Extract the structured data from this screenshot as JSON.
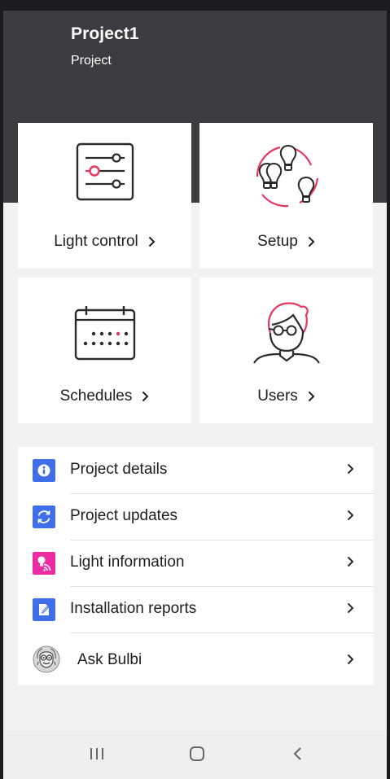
{
  "header": {
    "title": "Project1",
    "subtitle": "Project"
  },
  "tiles": [
    {
      "label": "Light control",
      "icon": "sliders-icon"
    },
    {
      "label": "Setup",
      "icon": "bulbs-setup-icon"
    },
    {
      "label": "Schedules",
      "icon": "calendar-icon"
    },
    {
      "label": "Users",
      "icon": "user-icon"
    }
  ],
  "menu": [
    {
      "label": "Project details",
      "icon": "info-icon",
      "color": "#3f6ee8"
    },
    {
      "label": "Project updates",
      "icon": "sync-icon",
      "color": "#3f6ee8"
    },
    {
      "label": "Light information",
      "icon": "light-info-icon",
      "color": "#ec2ca5"
    },
    {
      "label": "Installation reports",
      "icon": "report-edit-icon",
      "color": "#3f6ee8"
    },
    {
      "label": "Ask Bulbi",
      "icon": "bulbi-avatar-icon"
    }
  ],
  "navbar": {
    "items": [
      "recent-apps",
      "home",
      "back"
    ]
  },
  "colors": {
    "header": "#3c3c40",
    "accent": "#e8365d",
    "tile_bg": "#ffffff",
    "page_bg": "#f2f2f2"
  }
}
